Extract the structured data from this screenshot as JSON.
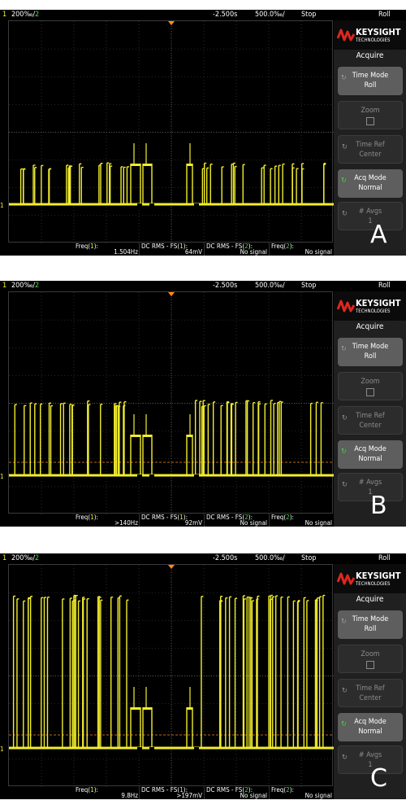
{
  "panels": [
    {
      "id": "A",
      "letter": "A",
      "ch1_number": "1",
      "ch1_scale": "200‰/",
      "ch2_number": "2",
      "time_offset": "-2.500s",
      "time_scale": "500.0‰/",
      "run_state": "Stop",
      "mode": "Roll",
      "brand": "KEYSIGHT",
      "brand_sub": "TECHNOLOGIES",
      "menu_title": "Acquire",
      "softkeys": [
        {
          "line1": "Time Mode",
          "line2": "Roll"
        },
        {
          "line1": "Zoom",
          "line2": ""
        },
        {
          "line1": "Time Ref",
          "line2": "Center"
        },
        {
          "line1": "Acq Mode",
          "line2": "Normal"
        },
        {
          "line1": "# Avgs",
          "line2": "1"
        }
      ],
      "measurements": [
        {
          "label_pre": "Freq(",
          "label_ch": "1",
          "label_post": "):",
          "value": "1.504Hz"
        },
        {
          "label_pre": "DC RMS - FS(",
          "label_ch": "1",
          "label_post": "):",
          "value": "64mV"
        },
        {
          "label_pre": "DC RMS - FS(",
          "label_ch": "2",
          "label_post": "):",
          "value": "No signal"
        },
        {
          "label_pre": "Freq(",
          "label_ch": "2",
          "label_post": "):",
          "value": "No signal"
        }
      ],
      "ground_marker": "1",
      "trace": {
        "pulse_height": 0.18,
        "dense": 0.55,
        "show_trigger_line": false
      }
    },
    {
      "id": "B",
      "letter": "B",
      "ch1_number": "1",
      "ch1_scale": "200‰/",
      "ch2_number": "2",
      "time_offset": "-2.500s",
      "time_scale": "500.0‰/",
      "run_state": "Stop",
      "mode": "Roll",
      "brand": "KEYSIGHT",
      "brand_sub": "TECHNOLOGIES",
      "menu_title": "Acquire",
      "softkeys": [
        {
          "line1": "Time Mode",
          "line2": "Roll"
        },
        {
          "line1": "Zoom",
          "line2": ""
        },
        {
          "line1": "Time Ref",
          "line2": "Center"
        },
        {
          "line1": "Acq Mode",
          "line2": "Normal"
        },
        {
          "line1": "# Avgs",
          "line2": "1"
        }
      ],
      "measurements": [
        {
          "label_pre": "Freq(",
          "label_ch": "1",
          "label_post": "):",
          "value": ">140Hz"
        },
        {
          "label_pre": "DC RMS - FS(",
          "label_ch": "1",
          "label_post": "):",
          "value": "92mV"
        },
        {
          "label_pre": "DC RMS - FS(",
          "label_ch": "2",
          "label_post": "):",
          "value": "No signal"
        },
        {
          "label_pre": "Freq(",
          "label_ch": "2",
          "label_post": "):",
          "value": "No signal"
        }
      ],
      "ground_marker": "1",
      "trace": {
        "pulse_height": 0.33,
        "dense": 0.8,
        "show_trigger_line": true
      }
    },
    {
      "id": "C",
      "letter": "C",
      "ch1_number": "1",
      "ch1_scale": "200‰/",
      "ch2_number": "2",
      "time_offset": "-2.500s",
      "time_scale": "500.0‰/",
      "run_state": "Stop",
      "mode": "Roll",
      "brand": "KEYSIGHT",
      "brand_sub": "TECHNOLOGIES",
      "menu_title": "Acquire",
      "softkeys": [
        {
          "line1": "Time Mode",
          "line2": "Roll"
        },
        {
          "line1": "Zoom",
          "line2": ""
        },
        {
          "line1": "Time Ref",
          "line2": "Center"
        },
        {
          "line1": "Acq Mode",
          "line2": "Normal"
        },
        {
          "line1": "# Avgs",
          "line2": "1"
        }
      ],
      "measurements": [
        {
          "label_pre": "Freq(",
          "label_ch": "1",
          "label_post": "):",
          "value": "9.8Hz"
        },
        {
          "label_pre": "DC RMS - FS(",
          "label_ch": "1",
          "label_post": "):",
          "value": ">197mV"
        },
        {
          "label_pre": "DC RMS - FS(",
          "label_ch": "2",
          "label_post": "):",
          "value": "No signal"
        },
        {
          "label_pre": "Freq(",
          "label_ch": "2",
          "label_post": "):",
          "value": "No signal"
        }
      ],
      "ground_marker": "1",
      "trace": {
        "pulse_height": 0.68,
        "dense": 0.95,
        "show_trigger_line": true
      }
    }
  ],
  "colors": {
    "ch1": "#f2ee2c",
    "ch2": "#4bd84b",
    "trigger_marker": "#ff8c1a",
    "grid": "#4a4a4a",
    "background": "#000000"
  },
  "icons": {
    "logo": "keysight-wave-icon",
    "softkey_arrow": "rotate-arrow-icon",
    "trigger": "trigger-marker-icon"
  }
}
